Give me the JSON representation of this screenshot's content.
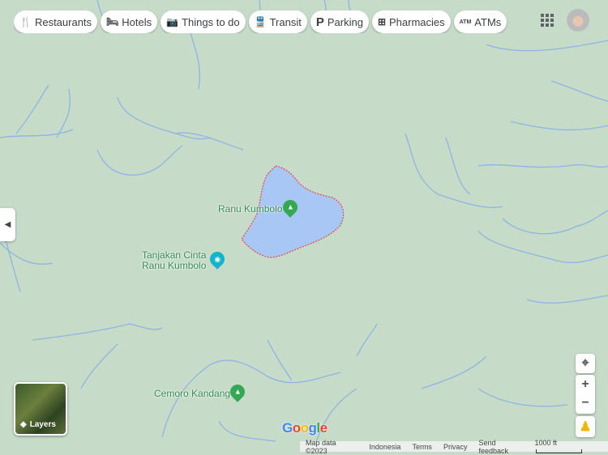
{
  "categories": [
    {
      "label": "Restaurants",
      "icon": "fork-knife-icon",
      "glyph": "🍴"
    },
    {
      "label": "Hotels",
      "icon": "bed-icon",
      "glyph": "🛏"
    },
    {
      "label": "Things to do",
      "icon": "camera-icon",
      "glyph": "📷"
    },
    {
      "label": "Transit",
      "icon": "train-icon",
      "glyph": "🚆"
    },
    {
      "label": "Parking",
      "icon": "parking-icon",
      "glyph": "P"
    },
    {
      "label": "Pharmacies",
      "icon": "pharmacy-icon",
      "glyph": "⊞"
    },
    {
      "label": "ATMs",
      "icon": "atm-icon",
      "glyph": "ATM"
    }
  ],
  "places": [
    {
      "name": "Ranu Kumbolo",
      "type": "campground",
      "color": "#34a853"
    },
    {
      "name": "Tanjakan Cinta\nRanu Kumbolo",
      "type": "viewpoint",
      "color": "#12b5cb"
    },
    {
      "name": "Cemoro Kandang",
      "type": "campground",
      "color": "#34a853"
    }
  ],
  "layers_label": "Layers",
  "logo": "Google",
  "footer": {
    "map_data": "Map data ©2023",
    "country": "Indonesia",
    "terms": "Terms",
    "privacy": "Privacy",
    "feedback": "Send feedback",
    "scale": "1000 ft"
  },
  "colors": {
    "land": "#c6dcc9",
    "water": "#a8c7f5",
    "river": "#8fb4e3",
    "lake_border": "#e05050"
  }
}
